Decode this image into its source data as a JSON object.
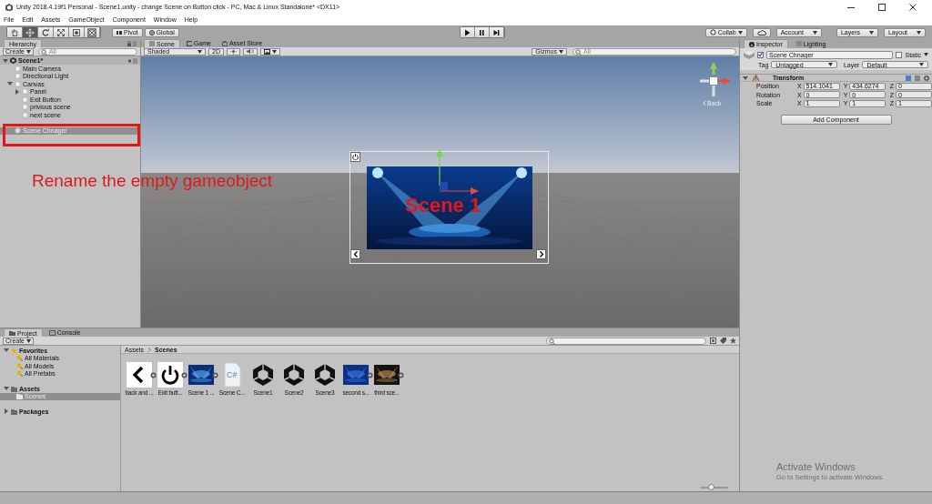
{
  "window": {
    "title": "Unity 2018.4.19f1 Personal - Scene1.unity - change Scene on Button click - PC, Mac & Linux Standalone* <DX11>"
  },
  "menu": [
    "File",
    "Edit",
    "Assets",
    "GameObject",
    "Component",
    "Window",
    "Help"
  ],
  "toolbar": {
    "tools": [
      {
        "kind": "hand",
        "selected": false
      },
      {
        "kind": "move",
        "selected": true
      },
      {
        "kind": "rotate",
        "selected": false
      },
      {
        "kind": "scale",
        "selected": false
      },
      {
        "kind": "rect",
        "selected": false
      },
      {
        "kind": "transform",
        "selected": false
      }
    ],
    "pivot": "Pivot",
    "global": "Global",
    "collab": "Collab",
    "account": "Account",
    "layers": "Layers",
    "layout": "Layout"
  },
  "hierarchy": {
    "tab": "Hierarchy",
    "create": "Create",
    "search_placeholder": "All",
    "scene": "Scene1*",
    "items": [
      {
        "label": "Main Camera",
        "selected": false
      },
      {
        "label": "Directional Light",
        "selected": false
      },
      {
        "label": "Canvas",
        "selected": false,
        "expanded": true,
        "children": [
          {
            "label": "Panel",
            "selected": false,
            "expanded": false
          },
          {
            "label": "Exit Button",
            "selected": false
          },
          {
            "label": "privious scene",
            "selected": false
          },
          {
            "label": "next scene",
            "selected": false
          }
        ]
      },
      {
        "label": "Scene Chnager",
        "selected": true
      }
    ]
  },
  "annotation": {
    "text": "Rename the empty gameobject"
  },
  "scene_view": {
    "tabs": [
      {
        "label": "Scene",
        "kind": "scene",
        "selected": true
      },
      {
        "label": "Game",
        "kind": "game",
        "selected": false
      },
      {
        "label": "Asset Store",
        "kind": "store",
        "selected": false
      }
    ],
    "shading": "Shaded",
    "mode_2d": "2D",
    "lighting_on": false,
    "audio_on": false,
    "gizmos": "Gizmos",
    "search_placeholder": "All",
    "back": "Back",
    "overlay_text": "Scene 1"
  },
  "inspector": {
    "tabs": [
      {
        "label": "Inspector",
        "kind": "info",
        "selected": true
      },
      {
        "label": "Lighting",
        "kind": "list",
        "selected": false
      }
    ],
    "object_name": "Scene Chnager",
    "active": true,
    "static": "Static",
    "static_checked": false,
    "tag_label": "Tag",
    "tag": "Untagged",
    "layer_label": "Layer",
    "layer": "Default",
    "component": "Transform",
    "rows": [
      {
        "label": "Position",
        "values": [
          {
            "axis": "X",
            "value": "514.1041"
          },
          {
            "axis": "Y",
            "value": "434.6274"
          },
          {
            "axis": "Z",
            "value": "0"
          }
        ]
      },
      {
        "label": "Rotation",
        "values": [
          {
            "axis": "X",
            "value": "0"
          },
          {
            "axis": "Y",
            "value": "0"
          },
          {
            "axis": "Z",
            "value": "0"
          }
        ]
      },
      {
        "label": "Scale",
        "values": [
          {
            "axis": "X",
            "value": "1"
          },
          {
            "axis": "Y",
            "value": "1"
          },
          {
            "axis": "Z",
            "value": "1"
          }
        ]
      }
    ],
    "add_component": "Add Component"
  },
  "project": {
    "tabs": [
      {
        "label": "Project",
        "kind": "folder",
        "selected": true
      },
      {
        "label": "Console",
        "kind": "console",
        "selected": false
      }
    ],
    "create": "Create",
    "tree": [
      {
        "label": "Favorites",
        "kind": "star",
        "expanded": true,
        "selected": false,
        "children": [
          {
            "label": "All Materials",
            "kind": "search",
            "selected": false
          },
          {
            "label": "All Models",
            "kind": "search",
            "selected": false
          },
          {
            "label": "All Prefabs",
            "kind": "search",
            "selected": false
          }
        ]
      },
      {
        "label": "Assets",
        "kind": "folder",
        "expanded": true,
        "selected": false,
        "children": [
          {
            "label": "Scenes",
            "kind": "folder",
            "selected": true
          }
        ]
      },
      {
        "label": "Packages",
        "kind": "folder",
        "expanded": false,
        "selected": false
      }
    ],
    "breadcrumb": [
      "Assets",
      "Scenes"
    ],
    "assets": [
      {
        "kind": "back",
        "label": "back and ..."
      },
      {
        "kind": "power",
        "label": "Exit butt..."
      },
      {
        "kind": "picture",
        "label": "Scene 1 ..."
      },
      {
        "kind": "script",
        "label": "Scene C...",
        "badge": "C#"
      },
      {
        "kind": "scene",
        "label": "Scene1"
      },
      {
        "kind": "scene",
        "label": "Scene2"
      },
      {
        "kind": "scene",
        "label": "Scene3"
      },
      {
        "kind": "picture",
        "label": "second s..."
      },
      {
        "kind": "picture",
        "label": "third sce..."
      }
    ],
    "icon_size_slider": {
      "level": 0.35
    }
  },
  "watermark": {
    "title": "Activate Windows",
    "detail": "Go to Settings to activate Windows."
  }
}
